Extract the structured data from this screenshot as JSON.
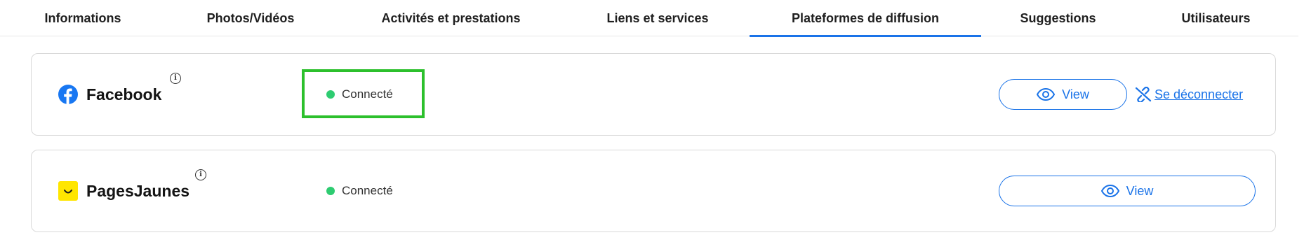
{
  "tabs": [
    {
      "label": "Informations"
    },
    {
      "label": "Photos/Vidéos"
    },
    {
      "label": "Activités et prestations"
    },
    {
      "label": "Liens et services"
    },
    {
      "label": "Plateformes de diffusion"
    },
    {
      "label": "Suggestions"
    },
    {
      "label": "Utilisateurs"
    }
  ],
  "active_tab": "Plateformes de diffusion",
  "platforms": [
    {
      "name": "Facebook",
      "info_icon": "info-icon",
      "status": "Connecté",
      "view_label": "View",
      "disconnect_label": "Se déconnecter"
    },
    {
      "name": "PagesJaunes",
      "info_icon": "info-icon",
      "status": "Connecté",
      "view_label": "View"
    }
  ],
  "colors": {
    "accent": "#1a73e8",
    "status_connected": "#2ecc71",
    "highlight_box": "#2cc02c",
    "facebook_blue": "#1877f2",
    "pagesjaunes_yellow": "#ffe600"
  }
}
